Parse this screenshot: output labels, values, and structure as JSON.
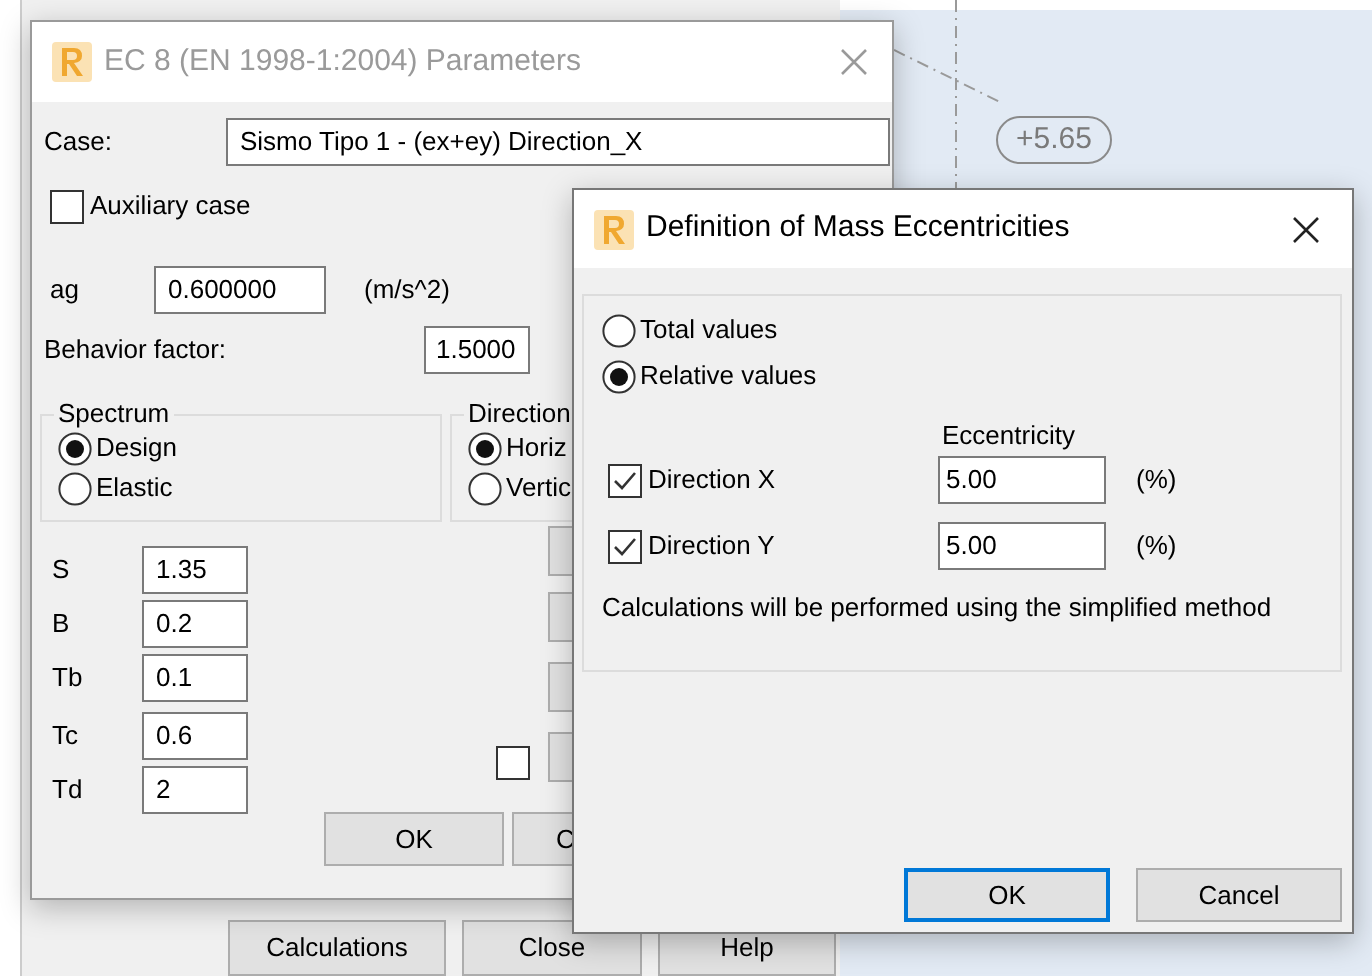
{
  "canvas": {
    "level_tag": "+5.65"
  },
  "main_window": {
    "buttons": [
      "Calculations",
      "Close",
      "Help"
    ]
  },
  "parameters_dialog": {
    "title": "EC 8 (EN 1998-1:2004) Parameters",
    "case": {
      "label": "Case:",
      "value": "Sismo Tipo 1 - (ex+ey) Direction_X"
    },
    "auxiliary_case": {
      "label": "Auxiliary case",
      "checked": false
    },
    "ag": {
      "label": "ag",
      "value": "0.600000",
      "unit": "(m/s^2)"
    },
    "behavior_factor": {
      "label": "Behavior factor:",
      "value": "1.5000"
    },
    "spectrum": {
      "title": "Spectrum",
      "options": [
        {
          "label": "Design",
          "selected": true
        },
        {
          "label": "Elastic",
          "selected": false
        }
      ]
    },
    "direction": {
      "title": "Direction",
      "options": [
        {
          "label": "Horiz",
          "selected": true
        },
        {
          "label": "Vertic",
          "selected": false
        }
      ]
    },
    "params": [
      {
        "label": "S",
        "value": "1.35"
      },
      {
        "label": "B",
        "value": "0.2"
      },
      {
        "label": "Tb",
        "value": "0.1"
      },
      {
        "label": "Tc",
        "value": "0.6"
      },
      {
        "label": "Td",
        "value": "2"
      }
    ],
    "side_checkbox": {
      "checked": false
    },
    "buttons": [
      "OK",
      "C"
    ]
  },
  "eccentricity_dialog": {
    "title": "Definition of Mass Eccentricities",
    "modes": [
      {
        "label": "Total values",
        "selected": false
      },
      {
        "label": "Relative values",
        "selected": true
      }
    ],
    "column_header": "Eccentricity",
    "directions": [
      {
        "label": "Direction X",
        "checked": true,
        "value": "5.00",
        "unit": "(%)"
      },
      {
        "label": "Direction Y",
        "checked": true,
        "value": "5.00",
        "unit": "(%)"
      }
    ],
    "note": "Calculations will be performed using the simplified method",
    "buttons": [
      {
        "label": "OK",
        "default": true
      },
      {
        "label": "Cancel",
        "default": false
      }
    ]
  }
}
